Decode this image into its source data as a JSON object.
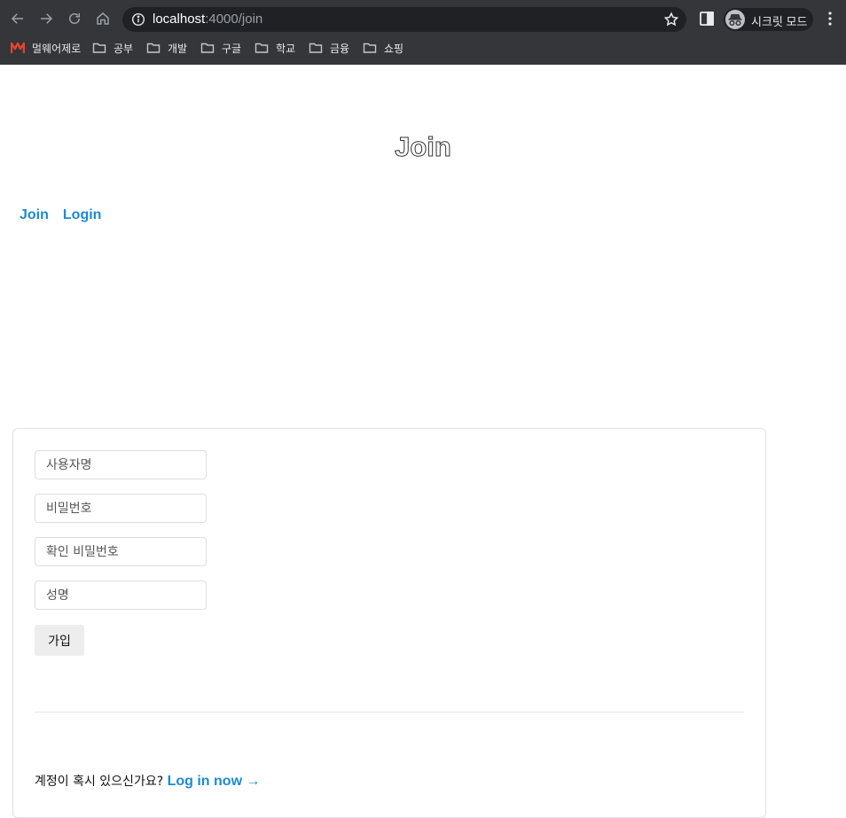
{
  "browser": {
    "url_host": "localhost",
    "url_path": ":4000/join",
    "incognito_label": "시크릿 모드",
    "bookmarks": [
      {
        "label": "멀웨어제로",
        "icon": "brand-m-icon"
      },
      {
        "label": "공부",
        "icon": "folder-icon"
      },
      {
        "label": "개발",
        "icon": "folder-icon"
      },
      {
        "label": "구글",
        "icon": "folder-icon"
      },
      {
        "label": "학교",
        "icon": "folder-icon"
      },
      {
        "label": "금융",
        "icon": "folder-icon"
      },
      {
        "label": "쇼핑",
        "icon": "folder-icon"
      }
    ]
  },
  "page": {
    "title": "Join",
    "nav": [
      {
        "label": "Join"
      },
      {
        "label": "Login"
      }
    ]
  },
  "form": {
    "username_placeholder": "사용자명",
    "password_placeholder": "비밀번호",
    "confirm_password_placeholder": "확인 비밀번호",
    "name_placeholder": "성명",
    "submit_label": "가입"
  },
  "footer": {
    "prompt": "계정이 혹시 있으신가요?",
    "link_label": "Log in now →"
  },
  "colors": {
    "link": "#1c8ad3",
    "chrome": "#35363a",
    "omnibox": "#202124"
  }
}
